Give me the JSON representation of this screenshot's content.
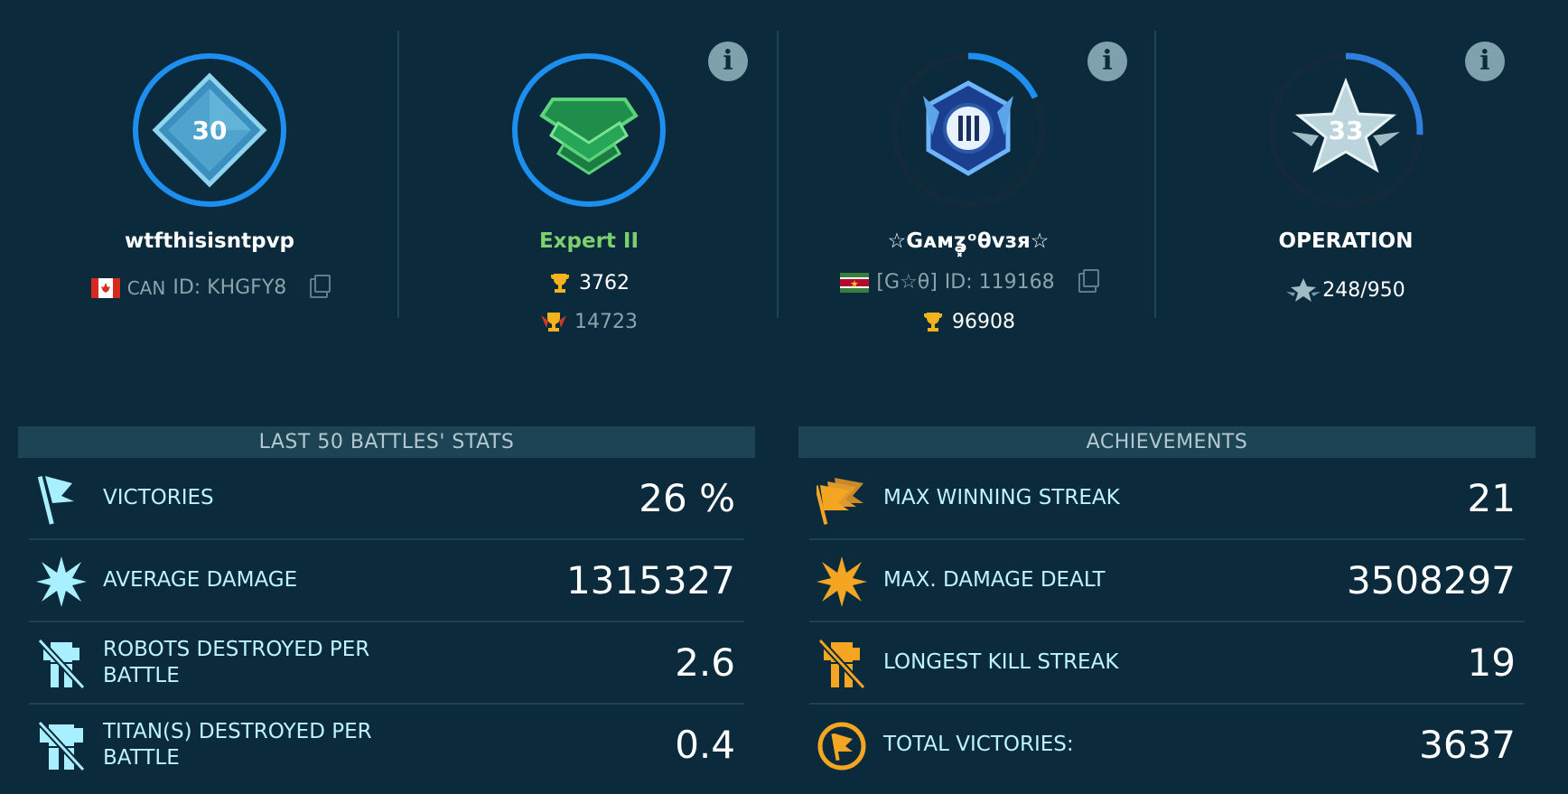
{
  "profile": {
    "level": "30",
    "username": "wtfthisisntpvp",
    "country": "CAN",
    "player_id": "ID: KHGFY8"
  },
  "league": {
    "rank": "Expert II",
    "trophies": "3762",
    "max_trophies": "14723"
  },
  "clan": {
    "name": "☆Gᴀᴍʓ͓ᵒθvзя☆",
    "tag": "[G☆θ]",
    "clan_id": "ID: 119168",
    "trophies": "96908"
  },
  "operation": {
    "level": "33",
    "title": "OPERATION",
    "progress_text": "248/950",
    "progress": 0.26
  },
  "battle_stats": {
    "header": "LAST 50 BATTLES' STATS",
    "rows": [
      {
        "label": "VICTORIES",
        "value": "26 %",
        "icon": "flag-icon"
      },
      {
        "label": "AVERAGE DAMAGE",
        "value": "1315327",
        "icon": "burst-icon"
      },
      {
        "label": "ROBOTS DESTROYED PER BATTLE",
        "value": "2.6",
        "icon": "robot-destroyed-icon"
      },
      {
        "label": "TITAN(S) DESTROYED PER BATTLE",
        "value": "0.4",
        "icon": "titan-destroyed-icon"
      }
    ]
  },
  "achievements": {
    "header": "ACHIEVEMENTS",
    "rows": [
      {
        "label": "MAX WINNING STREAK",
        "value": "21",
        "icon": "flags-streak-icon"
      },
      {
        "label": "MAX. DAMAGE DEALT",
        "value": "3508297",
        "icon": "burst-icon"
      },
      {
        "label": "LONGEST KILL STREAK",
        "value": "19",
        "icon": "robot-destroyed-icon"
      },
      {
        "label": "TOTAL VICTORIES:",
        "value": "3637",
        "icon": "victory-medal-icon"
      }
    ]
  },
  "colors": {
    "background": "#0b2a3b",
    "accent_blue": "#1d8ff0",
    "stat_label": "#bdf4ff",
    "league_green": "#7bd16d",
    "achievement_gold": "#f4a623"
  },
  "info_label": "i"
}
